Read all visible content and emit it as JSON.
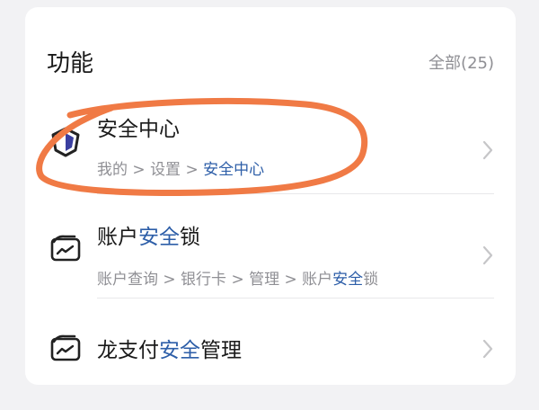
{
  "section": {
    "title": "功能",
    "all_label": "全部(25)"
  },
  "items": [
    {
      "title": "安全中心",
      "path_parts": [
        "我的",
        "设置",
        "安全中心"
      ],
      "path_sep": " > ",
      "icon": "shield-icon"
    },
    {
      "title_pre": "账户",
      "title_hl": "安全",
      "title_post": "锁",
      "path_plain": "账户查询 > 银行卡 > 管理 > 账户",
      "path_hl": "安全",
      "path_post": "锁",
      "icon": "wallet-icon"
    },
    {
      "title_pre": "龙支付",
      "title_hl": "安全",
      "title_post": "管理",
      "icon": "wallet-icon"
    }
  ],
  "colors": {
    "highlight": "#2d5ea8",
    "annotation": "#f07a45"
  }
}
